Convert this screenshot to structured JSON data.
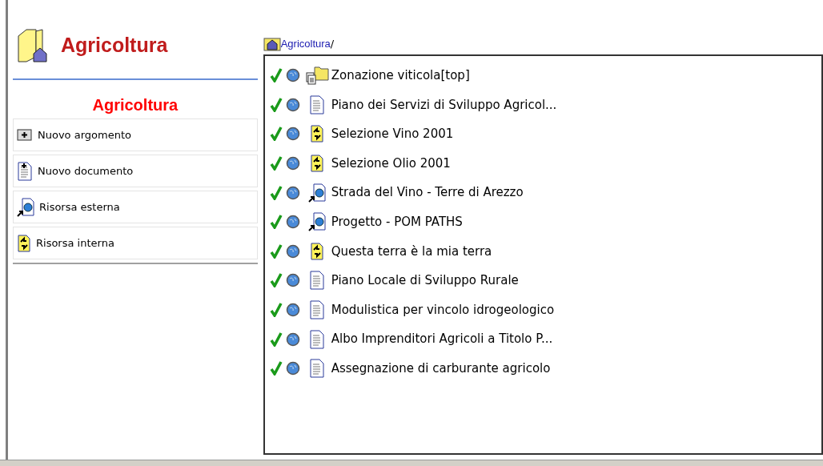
{
  "header": {
    "title": "Agricoltura"
  },
  "sidebar": {
    "title": "Agricoltura",
    "actions": [
      {
        "kind": "new-topic",
        "label": "Nuovo argomento"
      },
      {
        "kind": "new-document",
        "label": "Nuovo documento"
      },
      {
        "kind": "external",
        "label": "Risorsa esterna"
      },
      {
        "kind": "internal",
        "label": "Risorsa interna"
      }
    ]
  },
  "breadcrumb": {
    "link": "Agricoltura",
    "separator": "/"
  },
  "items": [
    {
      "kind": "folder",
      "label": "Zonazione viticola[top]"
    },
    {
      "kind": "document",
      "label": "Piano dei Servizi di Sviluppo Agricol..."
    },
    {
      "kind": "internal",
      "label": "Selezione Vino 2001"
    },
    {
      "kind": "internal",
      "label": "Selezione Olio 2001"
    },
    {
      "kind": "external",
      "label": "Strada del Vino - Terre di Arezzo"
    },
    {
      "kind": "external",
      "label": "Progetto - POM PATHS"
    },
    {
      "kind": "internal",
      "label": "Questa terra è la mia terra"
    },
    {
      "kind": "document",
      "label": "Piano Locale di Sviluppo Rurale"
    },
    {
      "kind": "document",
      "label": "Modulistica per vincolo idrogeologico"
    },
    {
      "kind": "document",
      "label": "Albo Imprenditori Agricoli a Titolo P..."
    },
    {
      "kind": "document",
      "label": "Assegnazione di carburante agricolo"
    }
  ]
}
